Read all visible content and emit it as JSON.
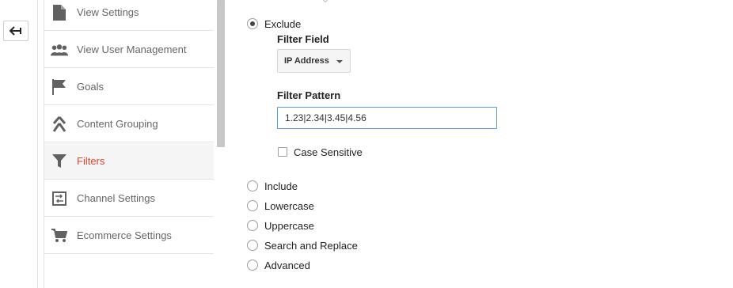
{
  "sidebar": {
    "items": [
      {
        "label": "View Settings",
        "icon": "document-icon",
        "active": false
      },
      {
        "label": "View User Management",
        "icon": "users-icon",
        "active": false
      },
      {
        "label": "Goals",
        "icon": "flag-icon",
        "active": false
      },
      {
        "label": "Content Grouping",
        "icon": "grouping-icon",
        "active": false
      },
      {
        "label": "Filters",
        "icon": "filter-icon",
        "active": true
      },
      {
        "label": "Channel Settings",
        "icon": "channel-icon",
        "active": false
      },
      {
        "label": "Ecommerce Settings",
        "icon": "cart-icon",
        "active": false
      }
    ]
  },
  "filter": {
    "options": [
      {
        "label": "Exclude",
        "checked": true
      },
      {
        "label": "Include",
        "checked": false
      },
      {
        "label": "Lowercase",
        "checked": false
      },
      {
        "label": "Uppercase",
        "checked": false
      },
      {
        "label": "Search and Replace",
        "checked": false
      },
      {
        "label": "Advanced",
        "checked": false
      }
    ],
    "field_label": "Filter Field",
    "field_value": "IP Address",
    "pattern_label": "Filter Pattern",
    "pattern_value": "1.23|2.34|3.45|4.56",
    "case_sensitive_label": "Case Sensitive",
    "case_sensitive_checked": false
  },
  "colors": {
    "active_text": "#d34836",
    "input_border": "#5b9bd5",
    "icon": "#616161"
  }
}
